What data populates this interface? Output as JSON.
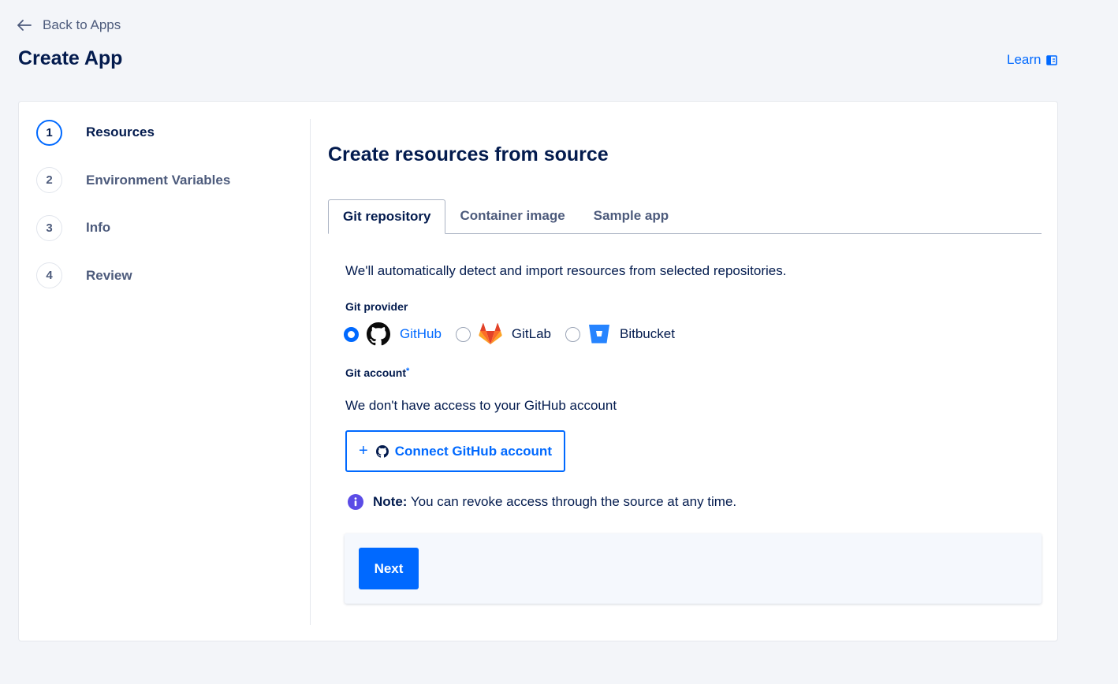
{
  "header": {
    "back_label": "Back to Apps",
    "title": "Create App",
    "learn_label": "Learn"
  },
  "steps": [
    {
      "number": "1",
      "label": "Resources",
      "active": true
    },
    {
      "number": "2",
      "label": "Environment Variables",
      "active": false
    },
    {
      "number": "3",
      "label": "Info",
      "active": false
    },
    {
      "number": "4",
      "label": "Review",
      "active": false
    }
  ],
  "main": {
    "title": "Create resources from source",
    "tabs": [
      {
        "label": "Git repository",
        "active": true
      },
      {
        "label": "Container image",
        "active": false
      },
      {
        "label": "Sample app",
        "active": false
      }
    ],
    "intro": "We'll automatically detect and import resources from selected repositories.",
    "git_provider_label": "Git provider",
    "providers": [
      {
        "name": "GitHub",
        "icon": "github-icon",
        "selected": true
      },
      {
        "name": "GitLab",
        "icon": "gitlab-icon",
        "selected": false
      },
      {
        "name": "Bitbucket",
        "icon": "bitbucket-icon",
        "selected": false
      }
    ],
    "git_account_label": "Git account",
    "git_account_required": "*",
    "no_access_text": "We don't have access to your GitHub account",
    "connect_button": {
      "plus": "+",
      "label": "Connect GitHub account"
    },
    "note": {
      "bold": "Note:",
      "text": " You can revoke access through the source at any time."
    },
    "next_label": "Next"
  },
  "colors": {
    "accent": "#0069ff",
    "text_primary": "#031b4e",
    "text_secondary": "#4d5b7c",
    "background": "#f3f5f9",
    "note_icon": "#5b4ce6",
    "gitlab": "#fc6d26",
    "bitbucket": "#2684ff"
  }
}
